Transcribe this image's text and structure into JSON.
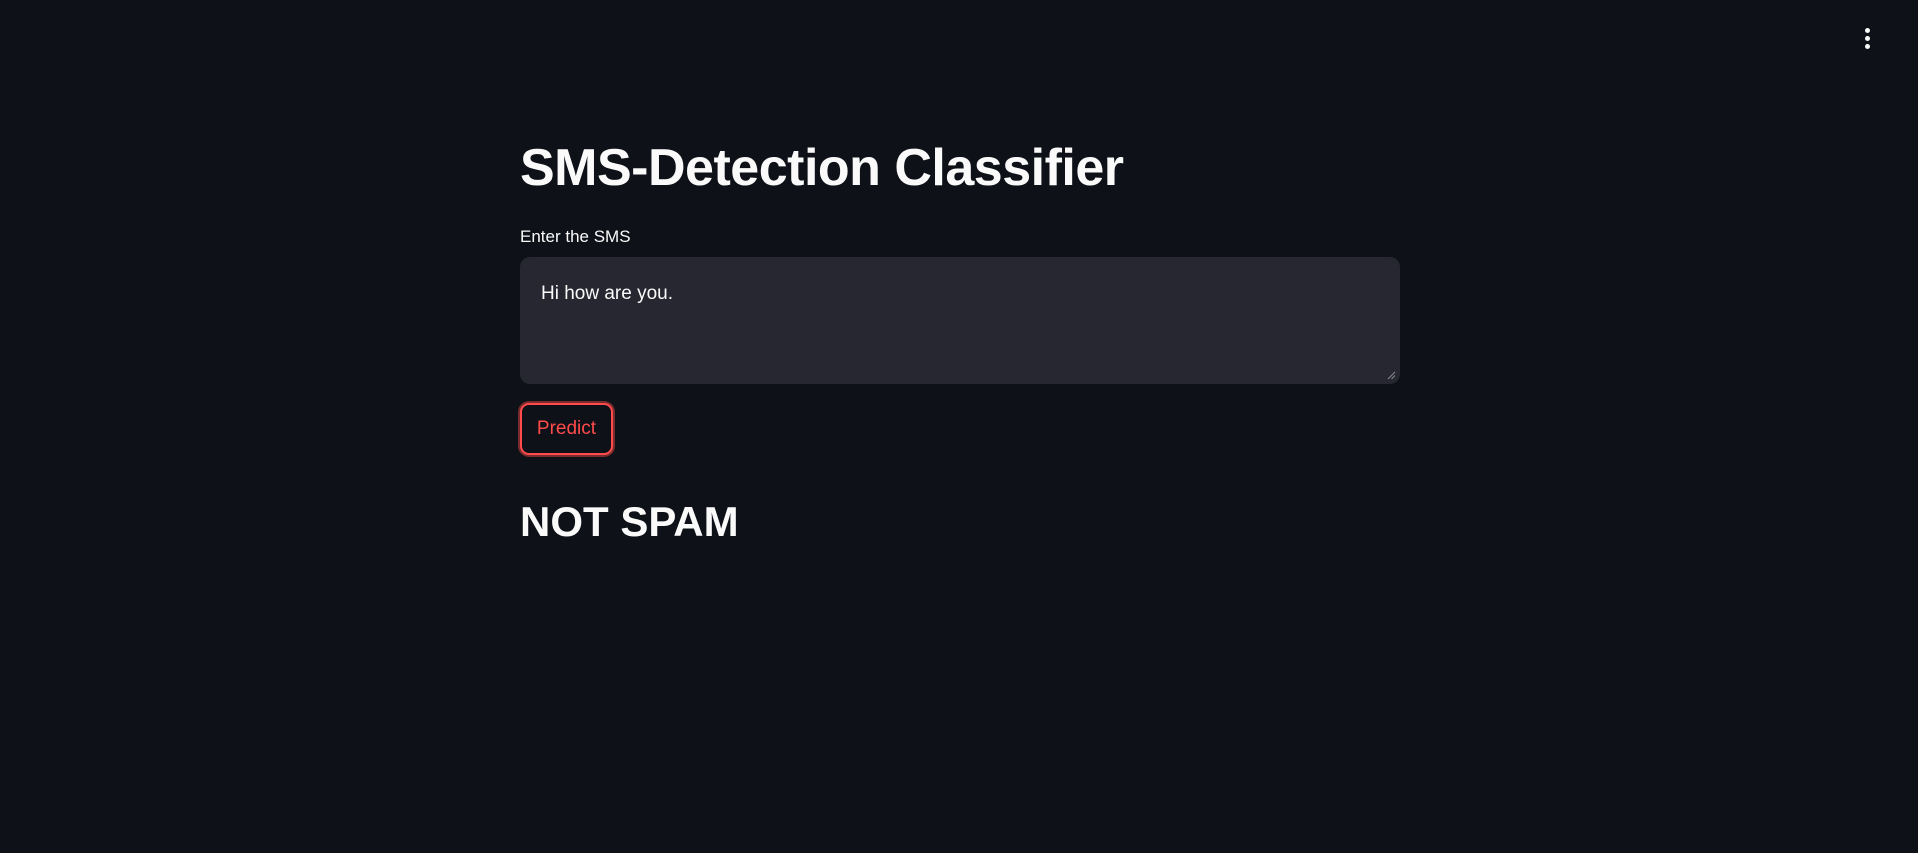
{
  "page": {
    "title": "SMS-Detection Classifier",
    "menu_icon": "kebab-menu-icon"
  },
  "input": {
    "label": "Enter the SMS",
    "value": "Hi how are you.",
    "placeholder": ""
  },
  "predict_button": {
    "label": "Predict"
  },
  "result": {
    "text": "NOT SPAM"
  },
  "colors": {
    "background": "#0e1117",
    "text": "#fafafa",
    "input_background": "#262730",
    "accent": "#ff4b4b"
  }
}
